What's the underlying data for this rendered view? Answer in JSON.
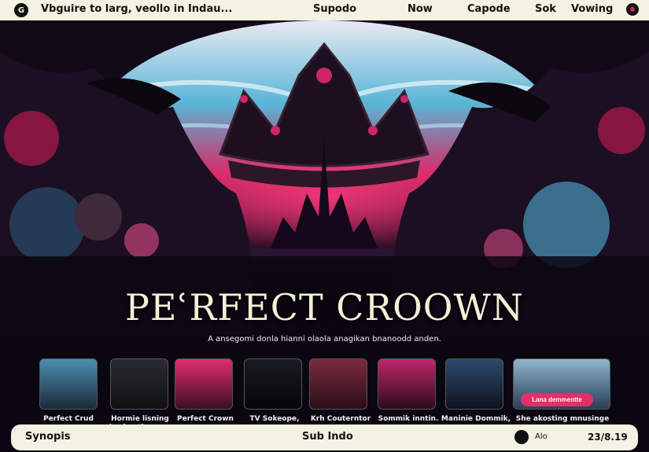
{
  "topbar": {
    "logo": "G",
    "search_text": "Vbguire to larg, veollo in Indau...",
    "nav": [
      "Supodo",
      "Now",
      "Capode",
      "Sok",
      "Vowing"
    ]
  },
  "hero": {
    "title": "PEʿRFECT CROOWN",
    "tagline": "A ansegomi donla hianni olaola anagikan bnanoodd anden."
  },
  "thumbnails": [
    {
      "caption": "Perfect Crud"
    },
    {
      "caption": "Hormie lisning\nlas beatlenage."
    },
    {
      "caption": "Perfect Crown"
    },
    {
      "caption": "TV Sokeope,"
    },
    {
      "caption": "Krh Couterntor"
    },
    {
      "caption": "Sommik inntin."
    },
    {
      "caption": "Maninie Dommik,"
    },
    {
      "caption": "She akosting mnusinge"
    }
  ],
  "watch_button": "Lana demmentte",
  "bottombar": {
    "synopsis": "Synopis",
    "sub": "Sub Indo",
    "alo": "Alo",
    "date": "23/8.19"
  },
  "colors": {
    "accent": "#e0306a",
    "bar": "#f4f2e2",
    "bg": "#0b0710"
  }
}
